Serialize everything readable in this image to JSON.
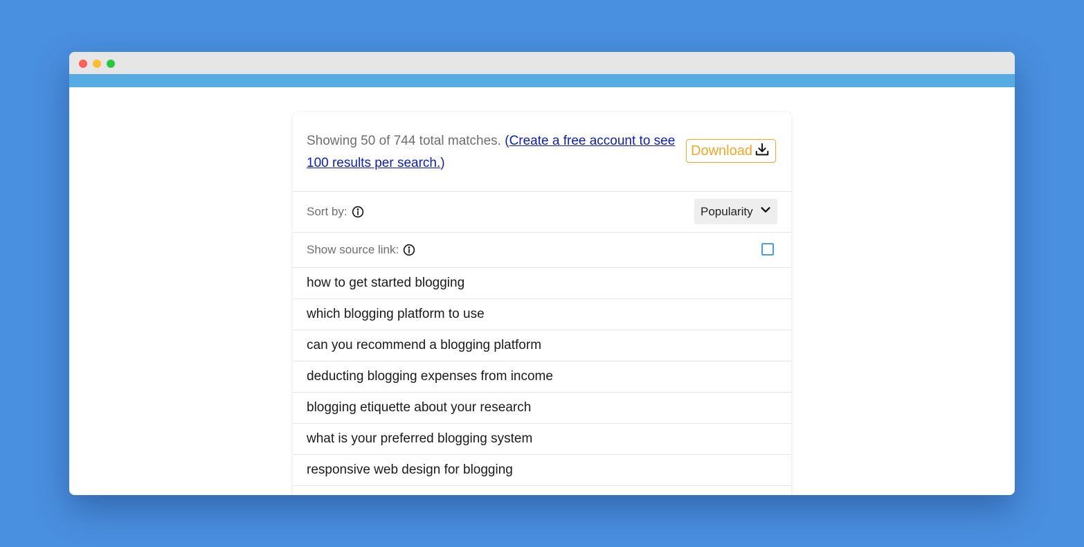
{
  "window": {
    "controls": [
      "close",
      "minimize",
      "maximize"
    ]
  },
  "results_panel": {
    "summary_text": "Showing 50 of 744 total matches. ",
    "paren_open": "(",
    "account_link": "Create a free account to see 100 results per search.",
    "paren_close": ")",
    "download_label": "Download",
    "download_icon": "download-icon",
    "accent_color": "#f5a623"
  },
  "sort": {
    "label": "Sort by:",
    "info_icon": "info-icon",
    "selected": "Popularity",
    "dropdown_icon": "chevron-down-icon"
  },
  "source_link": {
    "label": "Show source link:",
    "info_icon": "info-icon",
    "checked": false
  },
  "results": [
    {
      "text": "how to get started blogging"
    },
    {
      "text": "which blogging platform to use"
    },
    {
      "text": "can you recommend a blogging platform"
    },
    {
      "text": "deducting blogging expenses from income"
    },
    {
      "text": "blogging etiquette about your research"
    },
    {
      "text": "what is your preferred blogging system"
    },
    {
      "text": "responsive web design for blogging"
    }
  ]
}
